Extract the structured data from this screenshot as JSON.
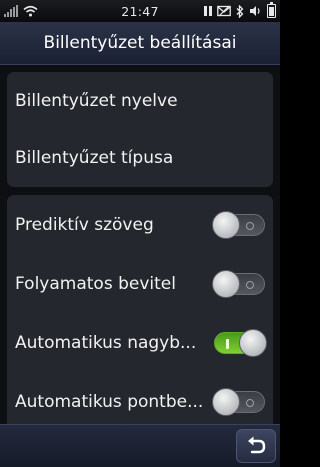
{
  "status_bar": {
    "time": "21:47",
    "icons": [
      "signal-icon",
      "wifi-icon",
      "pause-icon",
      "mail-icon",
      "bluetooth-icon",
      "volume-icon",
      "battery-icon"
    ]
  },
  "header": {
    "title": "Billentyűzet beállításai"
  },
  "group_1": {
    "items": [
      {
        "label": "Billentyűzet nyelve"
      },
      {
        "label": "Billentyűzet típusa"
      }
    ]
  },
  "group_2": {
    "items": [
      {
        "label": "Prediktív szöveg",
        "enabled": false
      },
      {
        "label": "Folyamatos bevitel",
        "enabled": false
      },
      {
        "label": "Automatikus nagyb...",
        "enabled": true
      },
      {
        "label": "Automatikus pontbe...",
        "enabled": false
      }
    ]
  },
  "footer": {
    "back_icon": "back-arrow-icon"
  },
  "colors": {
    "toggle_on": "#7fcf33",
    "title_bar": "#2b3348",
    "group_bg": "#24272d"
  }
}
